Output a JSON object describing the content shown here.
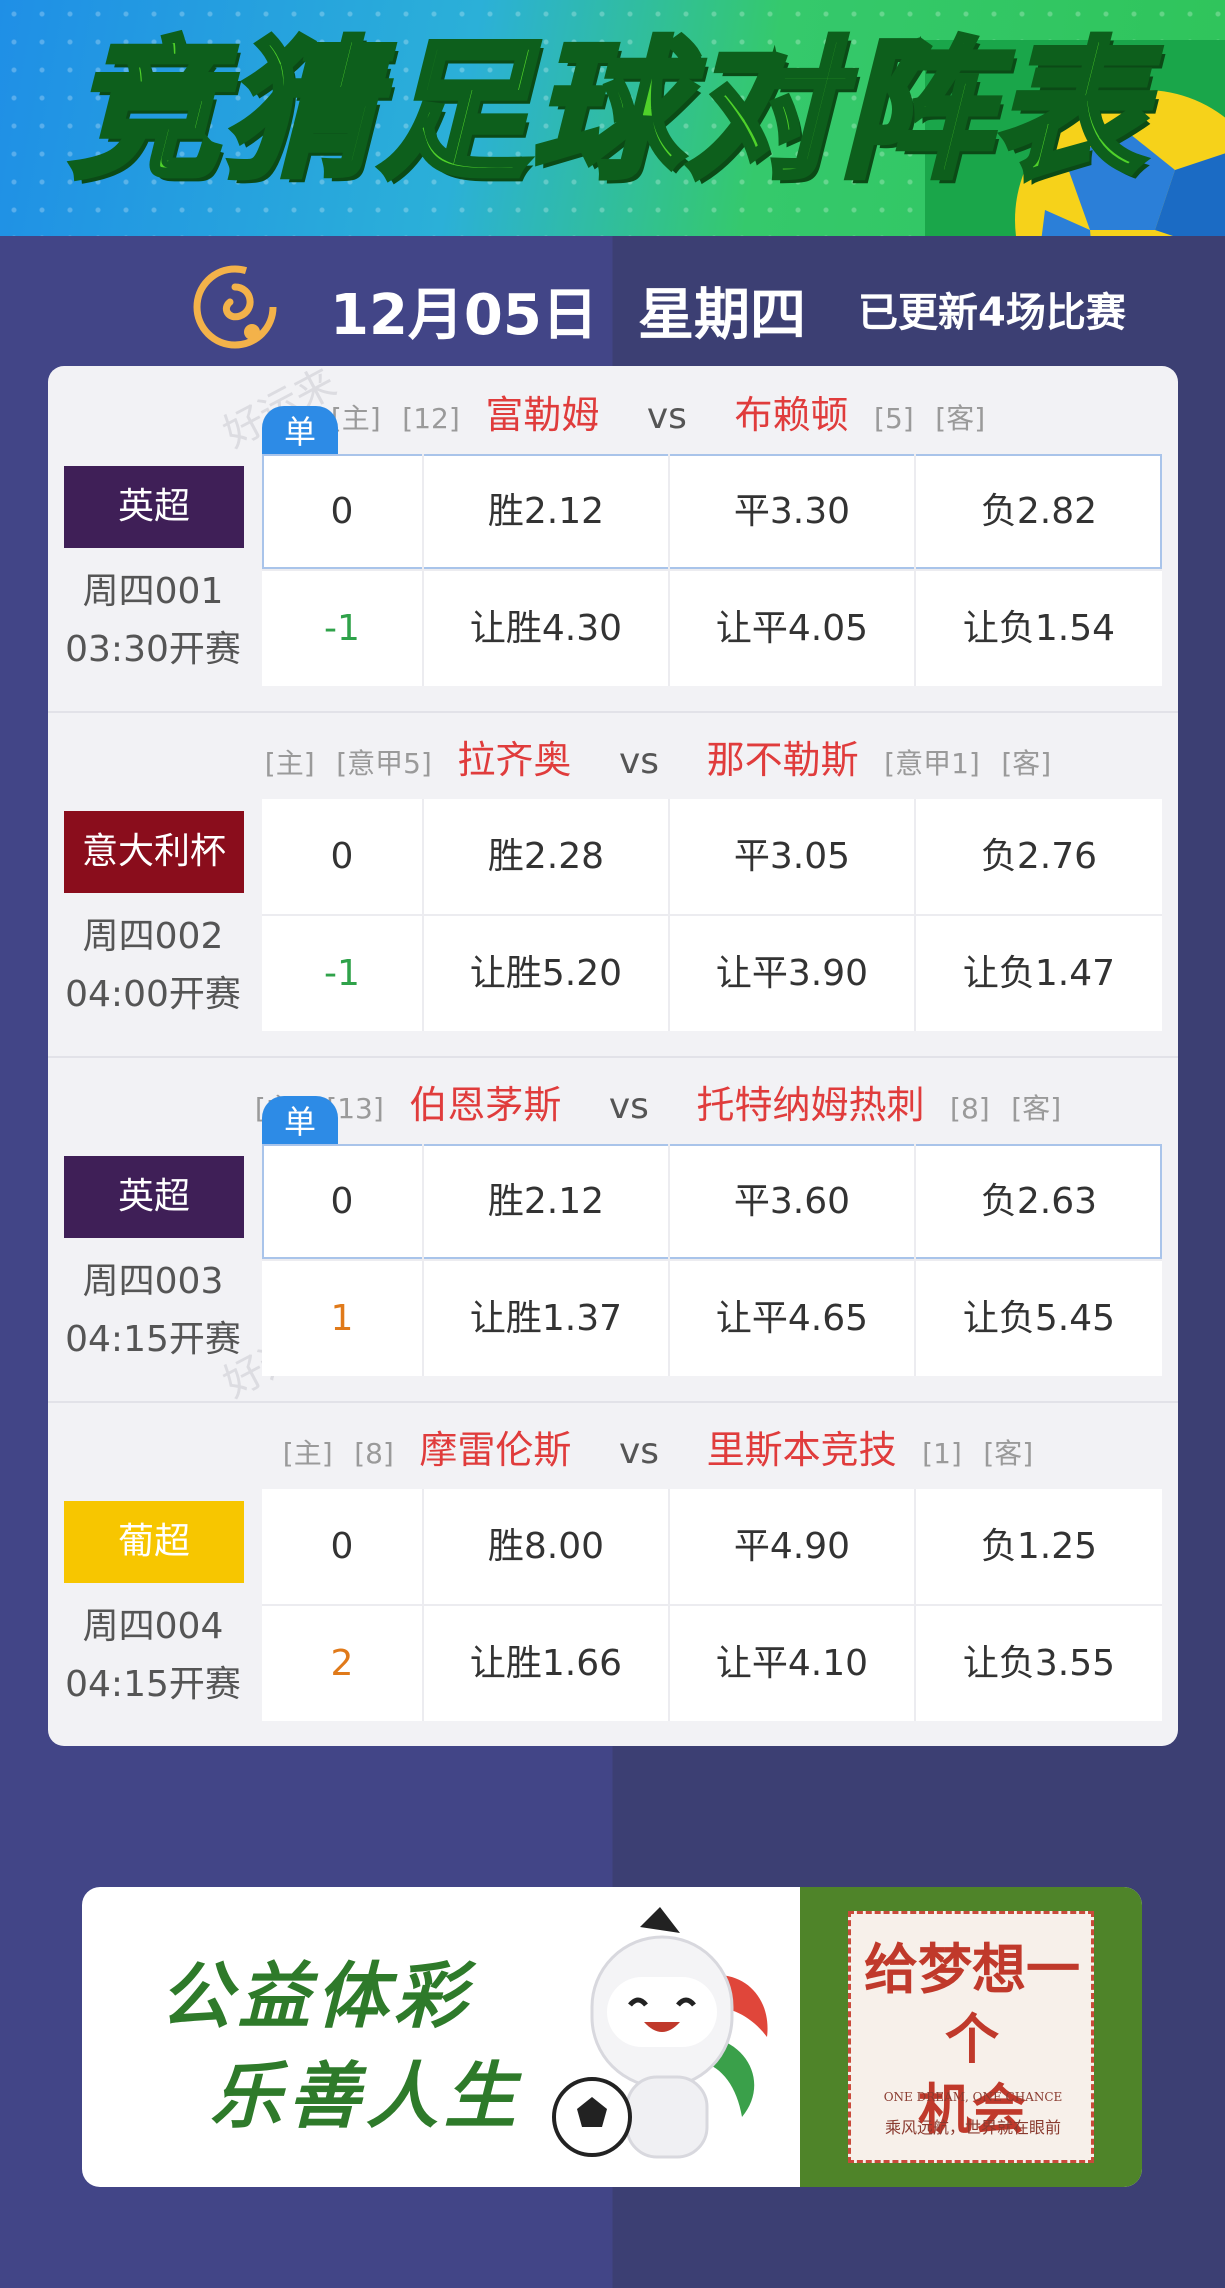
{
  "banner": {
    "title": "竞猜足球对阵表"
  },
  "date_row": {
    "date": "12月05日",
    "weekday": "星期四",
    "updated": "已更新4场比赛"
  },
  "watermark": "好运来",
  "single_badge": "单",
  "labels": {
    "home": "[主]",
    "away": "[客]",
    "vs": "vs"
  },
  "colors": {
    "epl": "#3f1f57",
    "coppa": "#8a0d1c",
    "liga_portugal": "#f7c600",
    "handicap_negative": "#2fa24a",
    "handicap_positive": "#e07a1a"
  },
  "matches": [
    {
      "home_rank": "[12]",
      "home": "富勒姆",
      "away": "布赖顿",
      "away_rank": "[5]",
      "league": "英超",
      "code": "周四001",
      "time": "03:30开赛",
      "single": true,
      "row1": {
        "handicap": "0",
        "win": "胜2.12",
        "draw": "平3.30",
        "lose": "负2.82"
      },
      "row2": {
        "handicap": "-1",
        "win": "让胜4.30",
        "draw": "让平4.05",
        "lose": "让负1.54"
      }
    },
    {
      "home_rank": "[意甲5]",
      "home": "拉齐奥",
      "away": "那不勒斯",
      "away_rank": "[意甲1]",
      "league": "意大利杯",
      "code": "周四002",
      "time": "04:00开赛",
      "single": false,
      "row1": {
        "handicap": "0",
        "win": "胜2.28",
        "draw": "平3.05",
        "lose": "负2.76"
      },
      "row2": {
        "handicap": "-1",
        "win": "让胜5.20",
        "draw": "让平3.90",
        "lose": "让负1.47"
      }
    },
    {
      "home_rank": "[13]",
      "home": "伯恩茅斯",
      "away": "托特纳姆热刺",
      "away_rank": "[8]",
      "league": "英超",
      "code": "周四003",
      "time": "04:15开赛",
      "single": true,
      "row1": {
        "handicap": "0",
        "win": "胜2.12",
        "draw": "平3.60",
        "lose": "负2.63"
      },
      "row2": {
        "handicap": "1",
        "win": "让胜1.37",
        "draw": "让平4.65",
        "lose": "让负5.45"
      }
    },
    {
      "home_rank": "[8]",
      "home": "摩雷伦斯",
      "away": "里斯本竞技",
      "away_rank": "[1]",
      "league": "葡超",
      "code": "周四004",
      "time": "04:15开赛",
      "single": false,
      "row1": {
        "handicap": "0",
        "win": "胜8.00",
        "draw": "平4.90",
        "lose": "负1.25"
      },
      "row2": {
        "handicap": "2",
        "win": "让胜1.66",
        "draw": "让平4.10",
        "lose": "让负3.55"
      }
    }
  ],
  "ad": {
    "line1": "公益体彩",
    "line2": "乐善人生",
    "poster_title_1": "给梦想一个",
    "poster_title_2": "机会",
    "poster_en": "ONE DREAM, ONE CHANCE",
    "poster_cn": "乘风远航，世界就在眼前"
  }
}
